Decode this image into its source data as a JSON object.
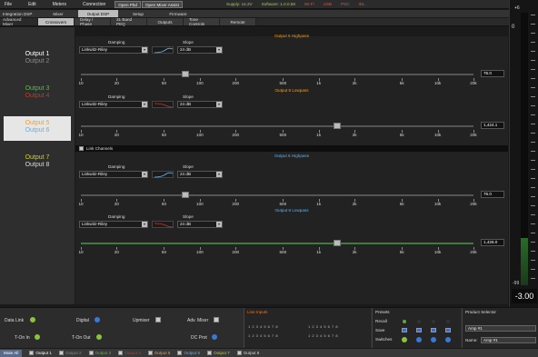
{
  "menubar": {
    "items": [
      "File",
      "Edit",
      "Meters",
      "Connection"
    ],
    "buttons": [
      "Open Pbd",
      "Open Mixer Assist"
    ],
    "status": {
      "supply": "Supply: 14.2V",
      "software": "Software: 1.0.0.58",
      "wifi": "Wi-Fi",
      "usb": "USB",
      "psc": "PSC",
      "idl": "IDL"
    }
  },
  "tabs_row1": [
    "Integration DSP",
    "Mixer",
    "Output DSP",
    "Setup",
    "Firmware"
  ],
  "tabs_row1_active": "Output DSP",
  "tabs_row2": [
    "Advanced Mixer",
    "Crossovers",
    "Delay / Phase",
    "31 Band PEQ",
    "Outputs",
    "Tone Controls",
    "Remote"
  ],
  "tabs_row2_active": "Crossovers",
  "outputs": [
    {
      "a": "Output 1",
      "b": "Output 2",
      "color_a": "#ffffff",
      "color_b": "#888888",
      "selected": false
    },
    {
      "a": "Output 3",
      "b": "Output 4",
      "color_a": "#5ab84a",
      "color_b": "#c0392b",
      "selected": false
    },
    {
      "a": "Output 5",
      "b": "Output 6",
      "color_a": "#f0a030",
      "color_b": "#6ab0e0",
      "selected": true
    },
    {
      "a": "Output 7",
      "b": "Output 8",
      "color_a": "#c8d030",
      "color_b": "#d8d8d8",
      "selected": false
    }
  ],
  "sections": [
    {
      "title": "Output 5 Highpass",
      "title_color": "#f0a030",
      "damping_label": "Damping",
      "damping_value": "Linkwitz-Riley",
      "slope_label": "Slope",
      "slope_value": "24 dB",
      "value": "76.0",
      "frequency_hz": 76.0
    },
    {
      "title": "Output 5 Lowpass",
      "title_color": "#f0a030",
      "damping_label": "Damping",
      "damping_value": "Linkwitz-Riley",
      "slope_label": "Slope",
      "slope_value": "24 dB",
      "value": "1,424.1",
      "frequency_hz": 1424.1
    },
    {
      "title": "Output 6 Highpass",
      "title_color": "#6ab0e0",
      "damping_label": "Damping",
      "damping_value": "Linkwitz-Riley",
      "slope_label": "Slope",
      "slope_value": "24 dB",
      "value": "76.0",
      "frequency_hz": 76.0
    },
    {
      "title": "Output 6 Lowpass",
      "title_color": "#6ab0e0",
      "damping_label": "Damping",
      "damping_value": "Linkwitz-Riley",
      "slope_label": "Slope",
      "slope_value": "24 dB",
      "value": "1,426.0",
      "frequency_hz": 1426.0
    }
  ],
  "scale_labels": [
    "10",
    "20",
    "50",
    "100",
    "200",
    "500",
    "1k",
    "2k",
    "5k",
    "10k",
    "20k"
  ],
  "scale_values": [
    10,
    20,
    50,
    100,
    200,
    500,
    1000,
    2000,
    5000,
    10000,
    20000
  ],
  "link_channels_label": "Link Channels",
  "meter": {
    "top": "+6",
    "zero": "0",
    "bottom": "-99",
    "value": "-3.00"
  },
  "bottom": {
    "data_link": "Data Link",
    "digital": "Digital",
    "upmixer": "Upmixer",
    "adv_mixer": "Adv. Mixer",
    "t_on_in": "T-On In",
    "t_on_out": "T-On Out",
    "dc_prot": "DC Prot",
    "line_inputs_title": "Line Inputs",
    "line_inputs_rows": [
      "1 2 3 4 5 6 7 8",
      "1 2 3 4 5 6 7 8"
    ],
    "presets_title": "Presets",
    "preset_rows": [
      "Recall",
      "Save",
      "Switches"
    ],
    "product_selector_title": "Product Selector",
    "product_value": "Amp #1",
    "name_label": "Name:",
    "name_value": "Amp #1"
  },
  "statusbar": {
    "mute_all": "Mute All",
    "outputs": [
      "Output 1",
      "Output 2",
      "Output 3",
      "Output 4",
      "Output 5",
      "Output 6",
      "Output 7",
      "Output 8"
    ],
    "output_colors": [
      "#ffffff",
      "#888888",
      "#5ab84a",
      "#c0392b",
      "#f0a030",
      "#6ab0e0",
      "#c8d030",
      "#d8d8d8"
    ]
  },
  "colors": {
    "accent_orange": "#f0a030",
    "accent_blue": "#6ab0e0",
    "status_green": "#9ad04a",
    "status_red": "#e84c3c"
  }
}
